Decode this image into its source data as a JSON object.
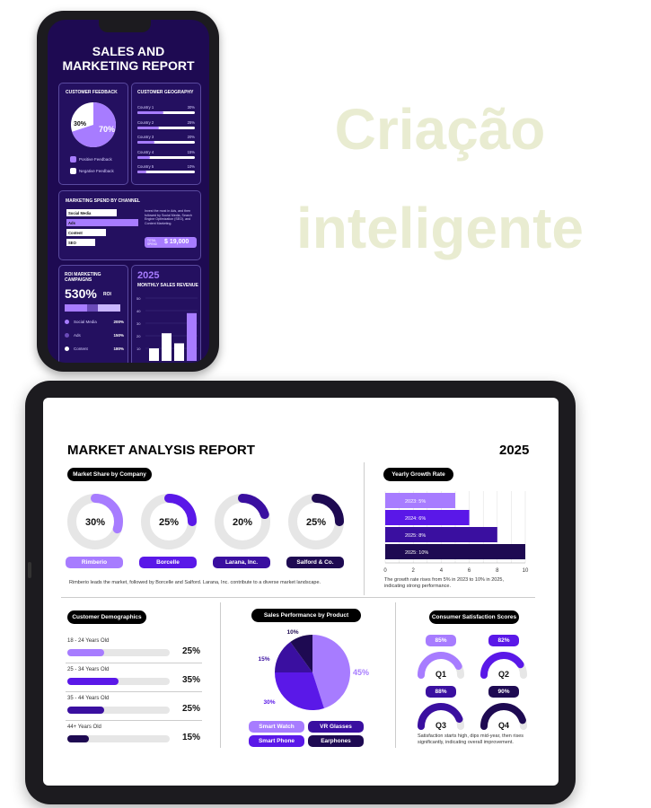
{
  "headline": {
    "line1": "Criação",
    "line2": "inteligente"
  },
  "phone": {
    "title_line1": "SALES AND",
    "title_line2": "MARKETING REPORT",
    "feedback": {
      "title": "CUSTOMER FEEDBACK",
      "positive_pct": "70%",
      "negative_pct": "30%",
      "positive_label": "Positive Feedback",
      "negative_label": "Negative Feedback"
    },
    "geography": {
      "title": "CUSTOMER GEOGRAPHY",
      "rows": [
        {
          "label": "Country 1",
          "value": "30%",
          "fill": 0.3
        },
        {
          "label": "Country 2",
          "value": "25%",
          "fill": 0.25
        },
        {
          "label": "Country 3",
          "value": "20%",
          "fill": 0.2
        },
        {
          "label": "Country 4",
          "value": "15%",
          "fill": 0.15
        },
        {
          "label": "Country 5",
          "value": "10%",
          "fill": 0.1
        }
      ]
    },
    "spend": {
      "title": "MARKETING SPEND BY CHANNEL",
      "channels": [
        {
          "label": "Social Media",
          "fill": 0.7
        },
        {
          "label": "Ads",
          "fill": 1.0
        },
        {
          "label": "Content",
          "fill": 0.55
        },
        {
          "label": "SEO",
          "fill": 0.4
        }
      ],
      "note": "Invest the most in Ads, and then followed by Social Media, Search Engine Optimization (SEO), and Content Marketing.",
      "total_label": "TOTAL SPEND",
      "total_value": "$ 19,000"
    },
    "roi": {
      "title": "ROI MARKETING CAMPAIGNS",
      "value": "530%",
      "unit": "ROI",
      "rows": [
        {
          "label": "Social Media",
          "value": "200%"
        },
        {
          "label": "Ads",
          "value": "150%"
        },
        {
          "label": "Content",
          "value": "180%"
        }
      ]
    },
    "revenue": {
      "year": "2025",
      "title": "MONTHLY SALES REVENUE",
      "ticks": [
        "50",
        "40",
        "30",
        "20",
        "10"
      ],
      "values": [
        10,
        22,
        14,
        38
      ]
    }
  },
  "tablet": {
    "title": "MARKET ANALYSIS REPORT",
    "year": "2025",
    "market_share": {
      "pill": "Market Share by Company",
      "companies": [
        {
          "name": "Rimberio",
          "pct": "30%",
          "value": 30,
          "color": "#a77cff"
        },
        {
          "name": "Borcelle",
          "pct": "25%",
          "value": 25,
          "color": "#5a18e8"
        },
        {
          "name": "Larana, Inc.",
          "pct": "20%",
          "value": 20,
          "color": "#3a0fa0"
        },
        {
          "name": "Salford & Co.",
          "pct": "25%",
          "value": 25,
          "color": "#1e0a52"
        }
      ],
      "caption": "Rimberio leads the market, followed by Borcelle and Salford. Larana, Inc. contribute to a diverse market landscape."
    },
    "growth": {
      "pill": "Yearly Growth Rate",
      "bars": [
        {
          "label": "2023: 5%",
          "value": 5,
          "color": "#a77cff"
        },
        {
          "label": "2024: 6%",
          "value": 6,
          "color": "#5a18e8"
        },
        {
          "label": "2025: 8%",
          "value": 8,
          "color": "#3a0fa0"
        },
        {
          "label": "2025: 10%",
          "value": 10,
          "color": "#1e0a52"
        }
      ],
      "ticks": [
        "0",
        "2",
        "4",
        "6",
        "8",
        "10"
      ],
      "caption": "The growth rate rises from 5% in 2023 to 10% in 2025, indicating strong performance."
    },
    "demographics": {
      "pill": "Customer Demographics",
      "rows": [
        {
          "label": "18 - 24 Years Old",
          "pct": "25%",
          "value": 25,
          "color": "#a77cff"
        },
        {
          "label": "25 - 34 Years Old",
          "pct": "35%",
          "value": 35,
          "color": "#5a18e8"
        },
        {
          "label": "35 - 44 Years Old",
          "pct": "25%",
          "value": 25,
          "color": "#3a0fa0"
        },
        {
          "label": "44+ Years Old",
          "pct": "15%",
          "value": 15,
          "color": "#1e0a52"
        }
      ]
    },
    "sales": {
      "pill": "Sales Performance by Product",
      "slices": [
        {
          "name": "Smart Watch",
          "pct": "45%",
          "value": 45,
          "color": "#a77cff"
        },
        {
          "name": "Smart Phone",
          "pct": "30%",
          "value": 30,
          "color": "#5a18e8"
        },
        {
          "name": "VR Glasses",
          "pct": "15%",
          "value": 15,
          "color": "#3a0fa0"
        },
        {
          "name": "Earphones",
          "pct": "10%",
          "value": 10,
          "color": "#1e0a52"
        }
      ],
      "legend": [
        "Smart Watch",
        "VR Glasses",
        "Smart Phone",
        "Earphones"
      ]
    },
    "satisfaction": {
      "pill": "Consumer Satisfaction Scores",
      "quarters": [
        {
          "q": "Q1",
          "pct": "85%",
          "value": 85,
          "color": "#a77cff"
        },
        {
          "q": "Q2",
          "pct": "82%",
          "value": 82,
          "color": "#5a18e8"
        },
        {
          "q": "Q3",
          "pct": "88%",
          "value": 88,
          "color": "#3a0fa0"
        },
        {
          "q": "Q4",
          "pct": "90%",
          "value": 90,
          "color": "#1e0a52"
        }
      ],
      "caption": "Satisfaction starts high, dips mid-year, then rises significantly, indicating overall improvement."
    }
  }
}
